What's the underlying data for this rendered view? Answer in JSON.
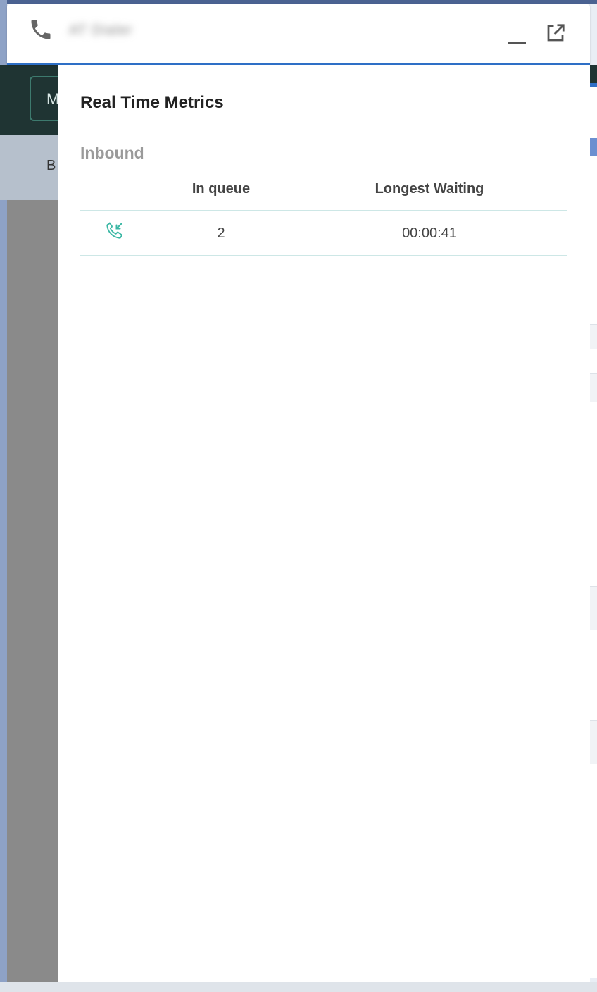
{
  "background": {
    "button_label": "M",
    "subbar_label": "B"
  },
  "titlebar": {
    "app_title": "AT Dialer",
    "phone_icon": "phone-icon",
    "minimize_icon": "minimize-icon",
    "popout_icon": "popout-icon",
    "accent_color": "#2e6fc6"
  },
  "panel": {
    "title": "Real Time Metrics",
    "section_label": "Inbound",
    "table": {
      "headers": [
        "In queue",
        "Longest Waiting"
      ],
      "rows": [
        {
          "icon": "incoming-call-icon",
          "in_queue": "2",
          "longest_waiting": "00:00:41"
        }
      ]
    },
    "icon_color": "#3ab7a4"
  }
}
